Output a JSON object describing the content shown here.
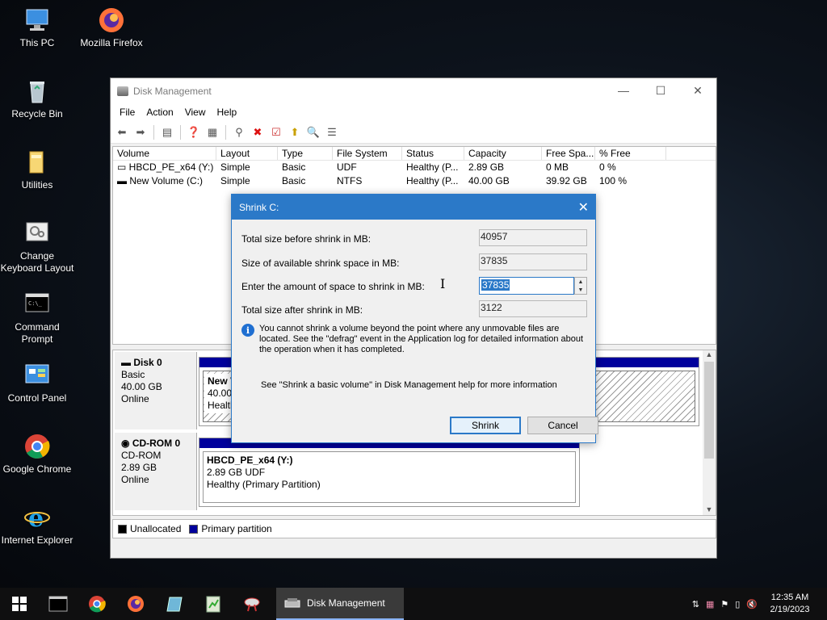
{
  "desktop": {
    "icons": [
      {
        "label": "This PC"
      },
      {
        "label": "Mozilla Firefox"
      },
      {
        "label": "Recycle Bin"
      },
      {
        "label": "Utilities"
      },
      {
        "label": "Change Keyboard Layout"
      },
      {
        "label": "Command Prompt"
      },
      {
        "label": "Control Panel"
      },
      {
        "label": "Google Chrome"
      },
      {
        "label": "Internet Explorer"
      }
    ]
  },
  "window": {
    "title": "Disk Management",
    "menu": [
      "File",
      "Action",
      "View",
      "Help"
    ],
    "columns": [
      "Volume",
      "Layout",
      "Type",
      "File System",
      "Status",
      "Capacity",
      "Free Spa...",
      "% Free"
    ],
    "rows": [
      [
        "HBCD_PE_x64 (Y:)",
        "Simple",
        "Basic",
        "UDF",
        "Healthy (P...",
        "2.89 GB",
        "0 MB",
        "0 %"
      ],
      [
        "New Volume (C:)",
        "Simple",
        "Basic",
        "NTFS",
        "Healthy (P...",
        "40.00 GB",
        "39.92 GB",
        "100 %"
      ]
    ],
    "disks": [
      {
        "name": "Disk 0",
        "type": "Basic",
        "size": "40.00 GB",
        "state": "Online",
        "partition": {
          "name": "New V",
          "size": "40.00 G",
          "status": "Healthy"
        }
      },
      {
        "name": "CD-ROM 0",
        "type": "CD-ROM",
        "size": "2.89 GB",
        "state": "Online",
        "partition": {
          "name": "HBCD_PE_x64  (Y:)",
          "size": "2.89 GB UDF",
          "status": "Healthy (Primary Partition)"
        }
      }
    ],
    "legend": {
      "unallocated": "Unallocated",
      "primary": "Primary partition"
    },
    "colors": {
      "primary": "#00009c",
      "unallocated": "#000000"
    }
  },
  "dialog": {
    "title": "Shrink C:",
    "total_before_label": "Total size before shrink in MB:",
    "total_before_value": "40957",
    "available_label": "Size of available shrink space in MB:",
    "available_value": "37835",
    "amount_label": "Enter the amount of space to shrink in MB:",
    "amount_value": "37835",
    "total_after_label": "Total size after shrink in MB:",
    "total_after_value": "3122",
    "info_text": "You cannot shrink a volume beyond the point where any unmovable files are located. See the \"defrag\" event in the Application log for detailed information about the operation when it has completed.",
    "help_text": "See \"Shrink a basic volume\" in Disk Management help for more information",
    "shrink_label": "Shrink",
    "cancel_label": "Cancel",
    "accent": "#2b79c8"
  },
  "taskbar": {
    "active_app": "Disk Management",
    "time": "12:35 AM",
    "date": "2/19/2023"
  }
}
